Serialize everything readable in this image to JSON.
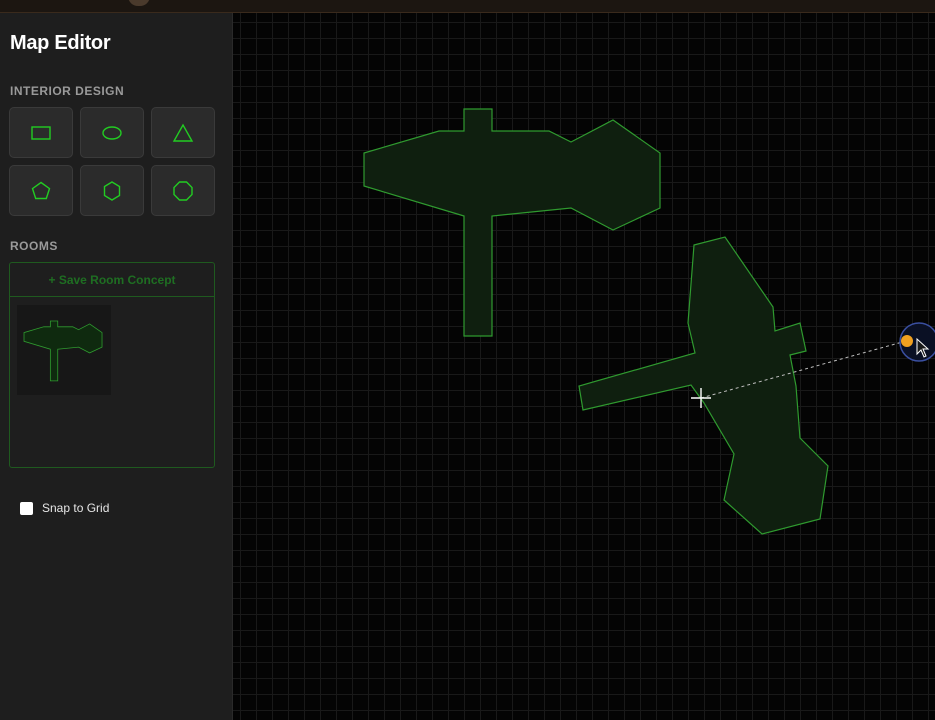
{
  "app": {
    "title": "Map Editor"
  },
  "sidebar": {
    "interior_design": {
      "label": "INTERIOR DESIGN",
      "tools": [
        {
          "name": "rectangle",
          "icon": "rectangle-icon"
        },
        {
          "name": "ellipse",
          "icon": "ellipse-icon"
        },
        {
          "name": "triangle",
          "icon": "triangle-icon"
        },
        {
          "name": "pentagon",
          "icon": "pentagon-icon"
        },
        {
          "name": "hexagon",
          "icon": "hexagon-icon"
        },
        {
          "name": "octagon",
          "icon": "octagon-icon"
        }
      ]
    },
    "rooms": {
      "label": "ROOMS",
      "save_button": "+ Save Room Concept",
      "items": [
        {
          "name": "room-concept-1",
          "icon": "room-thumbnail"
        }
      ]
    },
    "snap": {
      "label": "Snap to Grid",
      "checked": false
    }
  },
  "canvas": {
    "grid": true,
    "shapes": [
      {
        "name": "room-shape-1",
        "kind": "polygon"
      },
      {
        "name": "room-shape-2",
        "kind": "polygon",
        "state": "rotating"
      }
    ],
    "cursor": "crosshair",
    "rotation_handle": {
      "icon": "rotation-handle-icon"
    }
  },
  "colors": {
    "accent": "#22cc22",
    "shape_fill": "#0f1f0f",
    "shape_stroke": "#2f9a2f",
    "handle": "#f0a020",
    "sidebar_bg": "#1e1e1e",
    "canvas_bg": "#040404"
  }
}
